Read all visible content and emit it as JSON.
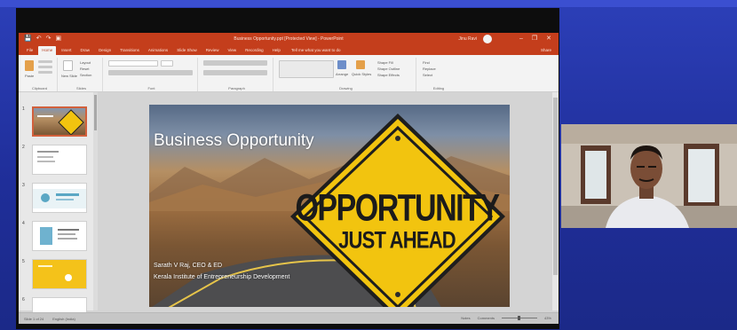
{
  "ppt": {
    "title": "Business Opportunity.ppt [Protected View] - PowerPoint",
    "user": "Jinu Ravi",
    "window_controls": [
      "–",
      "❐",
      "✕"
    ],
    "quick_access": [
      "💾",
      "↶",
      "↷",
      "▣"
    ],
    "tabs": [
      "File",
      "Home",
      "Insert",
      "Draw",
      "Design",
      "Transitions",
      "Animations",
      "Slide Show",
      "Review",
      "View",
      "Recording",
      "Help"
    ],
    "active_tab": "Home",
    "tell_me": "Tell me what you want to do",
    "share": "Share",
    "ribbon_groups": [
      "Clipboard",
      "Slides",
      "Font",
      "Paragraph",
      "Drawing",
      "Editing"
    ],
    "ribbon_labels": {
      "paste": "Paste",
      "new_slide": "New Slide",
      "layout": "Layout",
      "reset": "Reset",
      "section": "Section",
      "arrange": "Arrange",
      "quick_styles": "Quick Styles",
      "shape_fill": "Shape Fill",
      "shape_outline": "Shape Outline",
      "shape_effects": "Shape Effects",
      "find": "Find",
      "replace": "Replace",
      "select": "Select"
    },
    "thumbnail_numbers": [
      "1",
      "2",
      "3",
      "4",
      "5",
      "6"
    ]
  },
  "slide": {
    "title": "Business Opportunity",
    "sign_line1": "OPPORTUNITY",
    "sign_line2": "JUST AHEAD",
    "presenter_name": "Sarath V Raj, CEO & ED",
    "presenter_org": "Kerala Institute of Entrepreneurship Development"
  },
  "status": {
    "slide_pos": "Slide 1 of 24",
    "language": "English (India)",
    "notes": "Notes",
    "comments": "Comments",
    "zoom": "43%"
  },
  "colors": {
    "ppt_accent": "#c43e1c",
    "sign_yellow": "#f2c40f",
    "background_blue": "#2c3fb8"
  }
}
